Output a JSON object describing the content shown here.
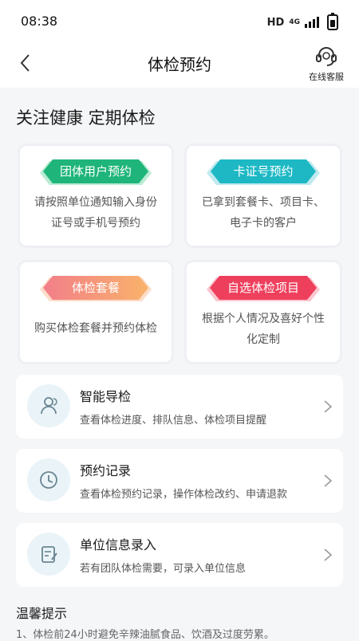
{
  "status": {
    "time": "08:38",
    "network": "HD",
    "network_type": "4G"
  },
  "header": {
    "title": "体检预约",
    "service_label": "在线客服"
  },
  "slogan": "关注健康 定期体检",
  "cards": [
    {
      "label": "团体用户预约",
      "desc": "请按照单位通知输入身份证号或手机号预约",
      "color": "#1fb57a"
    },
    {
      "label": "卡证号预约",
      "desc": "已拿到套餐卡、项目卡、电子卡的客户",
      "color": "#1db8c4"
    },
    {
      "label": "体检套餐",
      "desc": "购买体检套餐并预约体检",
      "color": "#f79a6d"
    },
    {
      "label": "自选体检项目",
      "desc": "根据个人情况及喜好个性化定制",
      "color": "#ee3f5c"
    }
  ],
  "list": [
    {
      "title": "智能导检",
      "sub": "查看体检进度、排队信息、体检项目提醒",
      "icon": "users-icon"
    },
    {
      "title": "预约记录",
      "sub": "查看体检预约记录，操作体检改约、申请退款",
      "icon": "clock-icon"
    },
    {
      "title": "单位信息录入",
      "sub": "若有团队体检需要，可录入单位信息",
      "icon": "edit-icon"
    }
  ],
  "tips": {
    "title": "温馨提示",
    "items": [
      "1、体检前24小时避免辛辣油腻食品、饮酒及过度劳累。"
    ]
  }
}
